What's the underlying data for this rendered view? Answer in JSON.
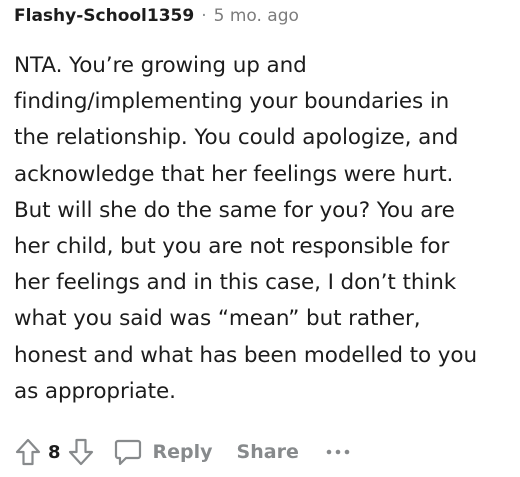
{
  "comment": {
    "author": "Flashy-School1359",
    "separator": "·",
    "age": "5 mo. ago",
    "lines": [
      "NTA. You’re growing up and",
      "finding/implementing your boundaries in",
      "the relationship. You could apologize, and",
      "acknowledge that her feelings were hurt.",
      "But will she do the same for you? You are",
      "her child, but you are not responsible for",
      "her feelings and in this case, I don’t think",
      "what you said was “mean” but rather,",
      "honest and what has been modelled to you",
      "as appropriate."
    ]
  },
  "actions": {
    "score": "8",
    "reply_label": "Reply",
    "share_label": "Share",
    "more_icon": "ellipsis-icon",
    "upvote_icon": "arrow-up-icon",
    "downvote_icon": "arrow-down-icon",
    "reply_icon": "speech-bubble-icon"
  },
  "colors": {
    "text": "#1c1c1c",
    "muted": "#878a8c",
    "background": "#ffffff"
  }
}
